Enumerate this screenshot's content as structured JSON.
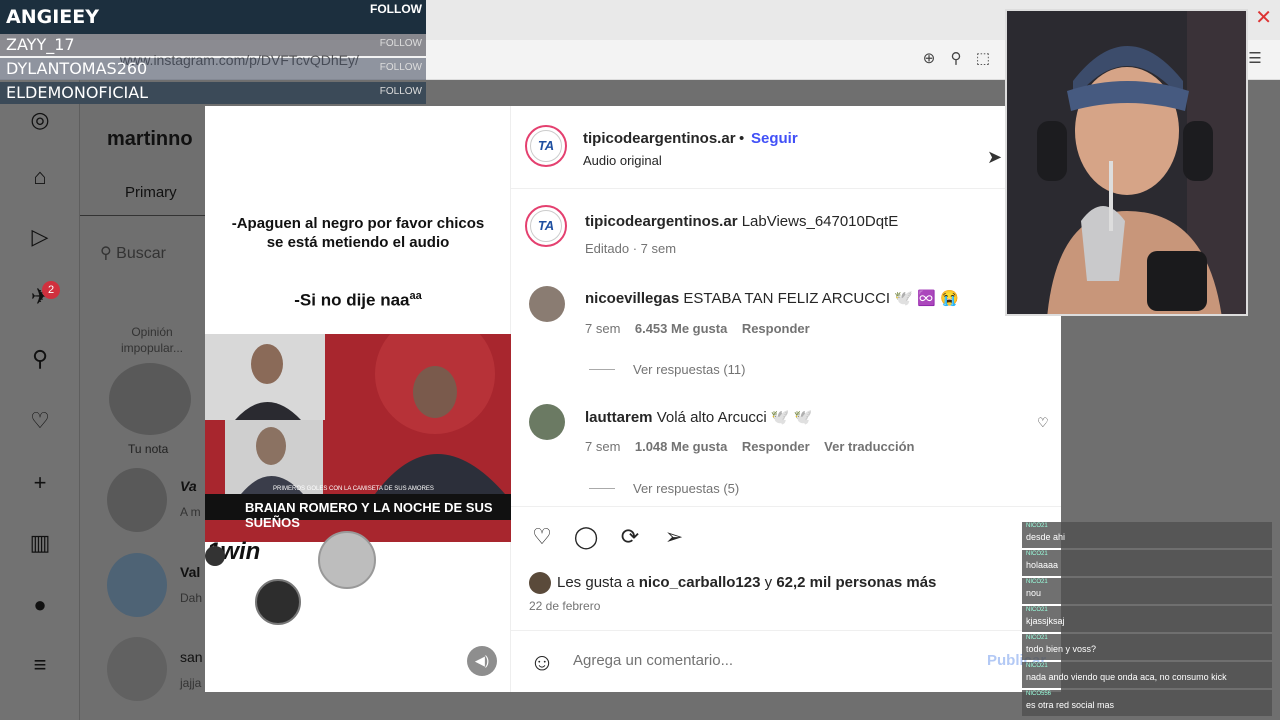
{
  "browser": {
    "url": "www.instagram.com/p/DVFTcvQDhEy/"
  },
  "stream": {
    "followers": [
      {
        "name": "ANGIEEY",
        "follow": "FOLLOW"
      },
      {
        "name": "ZAYY_17",
        "follow": "FOLLOW"
      },
      {
        "name": "DYLANTOMAS260",
        "follow": "FOLLOW"
      },
      {
        "name": "ELDEMONOFICIAL",
        "follow": "FOLLOW"
      }
    ],
    "chat": [
      {
        "user": "NICO21",
        "text": "desde ahi"
      },
      {
        "user": "NICO21",
        "text": "holaaaa"
      },
      {
        "user": "NICO21",
        "text": "nou"
      },
      {
        "user": "NICO21",
        "text": "kjassjksaj"
      },
      {
        "user": "NICO21",
        "text": "todo bien y voss?"
      },
      {
        "user": "NICO21",
        "text": "nada ando viendo que onda aca, no consumo kick"
      },
      {
        "user": "NICO556",
        "text": "es otra red social mas"
      }
    ]
  },
  "nav": {
    "badge": "2"
  },
  "inbox": {
    "username": "martinno",
    "tab": "Primary",
    "search": "Buscar",
    "note": "Opinión impopular...",
    "tu_nota": "Tu nota",
    "threads": [
      {
        "name": "Va",
        "preview": "A m"
      },
      {
        "name": "Val",
        "preview": "Dah"
      },
      {
        "name": "san",
        "preview": "jajja"
      }
    ]
  },
  "post": {
    "caption_line1": "-Apaguen al negro por favor chicos se está metiendo el audio",
    "caption_line2": "-Si no dije naa",
    "caption_sup": "aa",
    "banner": "BRAIAN ROMERO Y LA NOCHE DE SUS SUEÑOS",
    "banner_small": "PRIMEROS GOLES CON LA CAMISETA DE SUS AMORES",
    "brand": "1win",
    "author": "tipicodeargentinos.ar",
    "dot": "•",
    "follow": "Seguir",
    "audio": "Audio original",
    "avatar_initials": "TA",
    "owner_comment": {
      "user": "tipicodeargentinos.ar",
      "text": "LabViews_647010DqtE",
      "meta": "Editado · 7 sem"
    },
    "comments": [
      {
        "user": "nicoevillegas",
        "text": "ESTABA TAN FELIZ ARCUCCI 🕊️ ♾️ 😭",
        "time": "7 sem",
        "likes": "6.453 Me gusta",
        "reply": "Responder",
        "translate": "",
        "replies": "Ver respuestas (11)"
      },
      {
        "user": "lauttarem",
        "text": "Volá alto Arcucci 🕊️ 🕊️",
        "time": "7 sem",
        "likes": "1.048 Me gusta",
        "reply": "Responder",
        "translate": "Ver traducción",
        "replies": "Ver respuestas (5)"
      }
    ],
    "likes_prefix": "Les gusta a",
    "likes_user": "nico_carballo123",
    "likes_mid": "y",
    "likes_count": "62,2 mil personas más",
    "date": "22 de febrero",
    "comment_placeholder": "Agrega un comentario...",
    "publish": "Publicar"
  },
  "colors": {
    "follow_blue": "#4150f7",
    "badge_red": "#d0303e",
    "ring_pink": "#e4406f"
  }
}
